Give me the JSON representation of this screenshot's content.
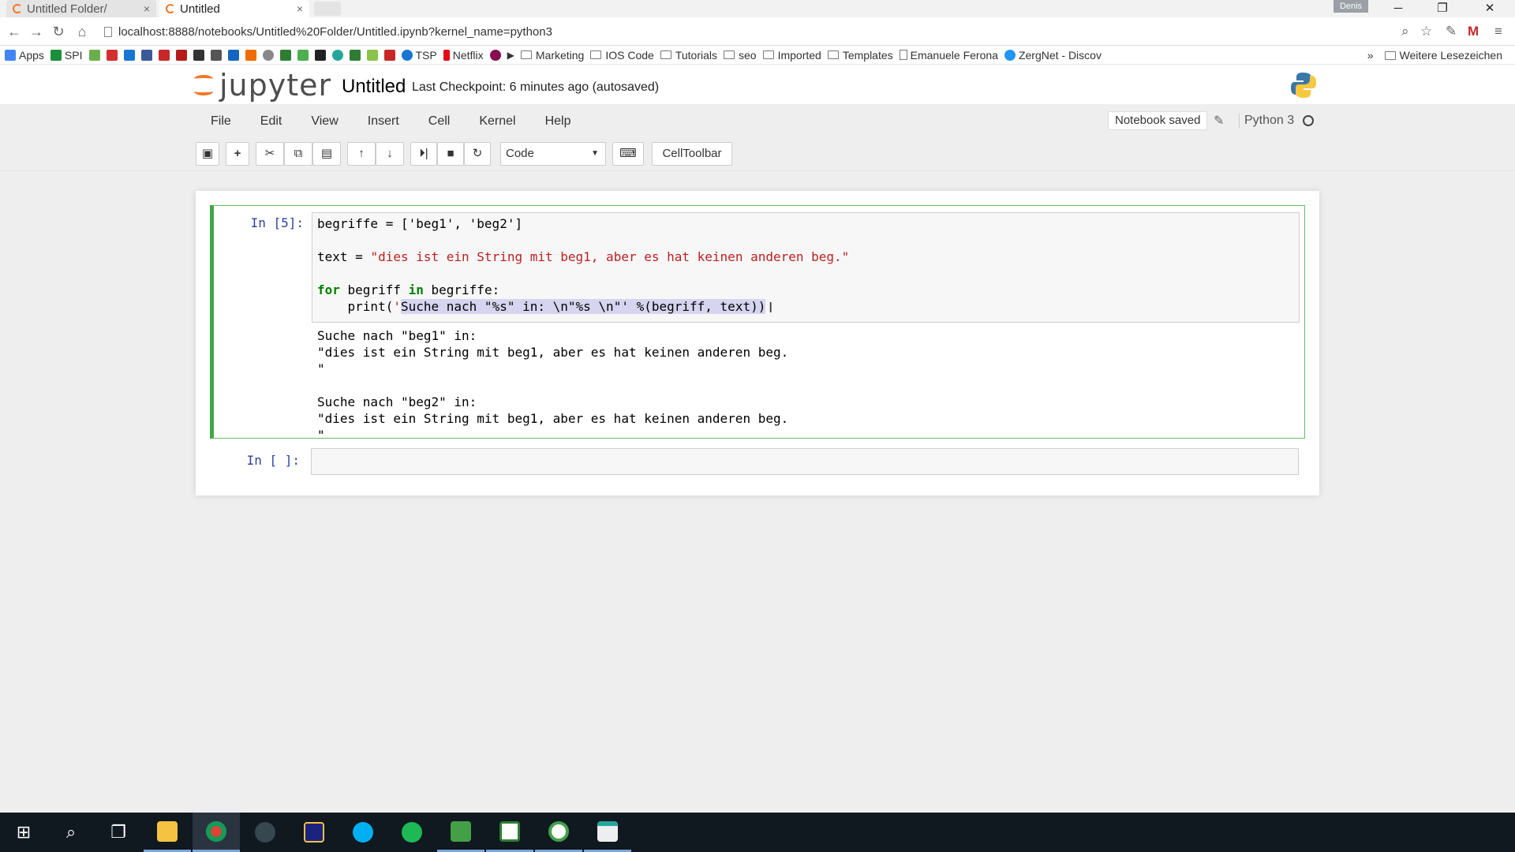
{
  "browser": {
    "tabs": [
      {
        "title": "Untitled Folder/",
        "close": "×"
      },
      {
        "title": "Untitled",
        "close": "×"
      }
    ],
    "profile": "Denis",
    "window_controls": {
      "minimize": "─",
      "restore": "❐",
      "close": "✕"
    },
    "url": "localhost:8888/notebooks/Untitled%20Folder/Untitled.ipynb?kernel_name=python3",
    "bookmarks": [
      {
        "label": "Apps",
        "color": "#4285f4"
      },
      {
        "label": "SPI",
        "color": "#1a8f3c"
      },
      {
        "label": "TSP",
        "color": "#1976d2"
      },
      {
        "label": "Netflix",
        "color": "#e50914"
      },
      {
        "label": "Marketing",
        "folder": true
      },
      {
        "label": "IOS Code",
        "folder": true
      },
      {
        "label": "Tutorials",
        "folder": true
      },
      {
        "label": "seo",
        "folder": true
      },
      {
        "label": "Imported",
        "folder": true
      },
      {
        "label": "Templates",
        "folder": true
      },
      {
        "label": "Emanuele Ferona",
        "folder": false
      },
      {
        "label": "ZergNet - Discov",
        "color": "#2196f3"
      }
    ],
    "bookmarks_more": "»",
    "other_bookmarks": "Weitere Lesezeichen"
  },
  "jupyter": {
    "logo_text": "jupyter",
    "notebook_title": "Untitled",
    "checkpoint": "Last Checkpoint: 6 minutes ago (autosaved)",
    "menus": [
      "File",
      "Edit",
      "View",
      "Insert",
      "Cell",
      "Kernel",
      "Help"
    ],
    "notebook_saved": "Notebook saved",
    "kernel": "Python 3",
    "cell_type": "Code",
    "celltoolbar": "CellToolbar",
    "accent": "#f37726"
  },
  "cells": {
    "cell1": {
      "prompt": "In [5]:",
      "code": {
        "line1": "begriffe = ['beg1', 'beg2']",
        "line2_var": "text = ",
        "line2_str": "\"dies ist ein String mit beg1, aber es hat keinen anderen beg.\"",
        "line3_kw1": "for",
        "line3_a": " begriff ",
        "line3_kw2": "in",
        "line3_b": " begriffe:",
        "line4_a": "    print(",
        "line4_q": "'",
        "line4_sel": "Suche nach \"%s\" in: \\n\"%s \\n\"' %(begriff, text))"
      },
      "output": [
        "Suche nach \"beg1\" in:",
        "\"dies ist ein String mit beg1, aber es hat keinen anderen beg.",
        "\"",
        "",
        "Suche nach \"beg2\" in:",
        "\"dies ist ein String mit beg1, aber es hat keinen anderen beg.",
        "\""
      ]
    },
    "cell2": {
      "prompt": "In [ ]:"
    }
  }
}
